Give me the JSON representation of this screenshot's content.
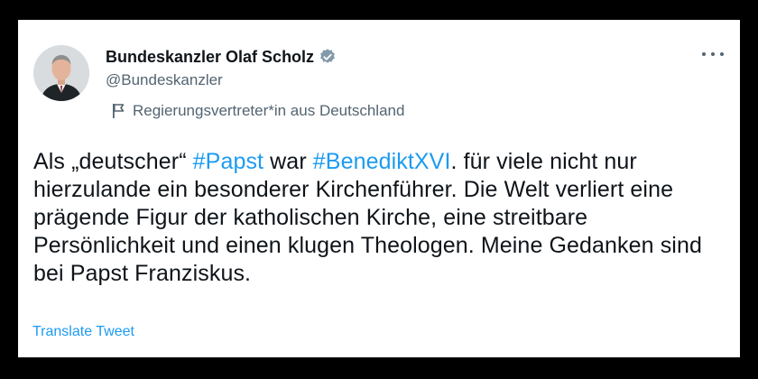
{
  "tweet": {
    "author": {
      "display_name": "Bundeskanzler Olaf Scholz",
      "handle": "@Bundeskanzler",
      "verified": true,
      "affiliation_label": "Regierungsvertreter*in aus Deutschland",
      "verified_icon": "verified-badge-icon",
      "affiliation_icon": "flag-icon"
    },
    "more_icon": "more-options-icon",
    "text": {
      "seg1": "Als „deutscher“ ",
      "hashtag1": "#Papst",
      "seg2": " war ",
      "hashtag2": "#BenediktXVI",
      "seg3": ". für viele nicht nur hierzulande ein besonderer Kirchenführer. Die Welt verliert eine prägende Figur der katholischen Kirche, eine streitbare Persönlichkeit und einen klugen Theologen. Meine Gedanken sind bei Papst Franziskus."
    },
    "translate_label": "Translate Tweet"
  },
  "colors": {
    "background": "#000000",
    "card": "#ffffff",
    "text": "#0f1419",
    "secondary": "#536471",
    "link": "#1d9bf0"
  }
}
